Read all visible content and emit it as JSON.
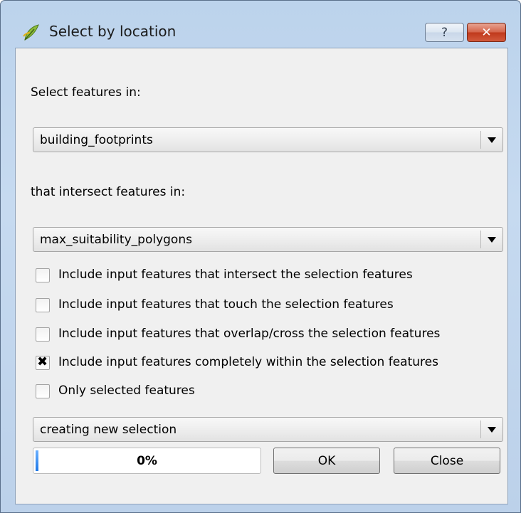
{
  "window": {
    "title": "Select by location",
    "help_glyph": "?",
    "close_glyph": "✕"
  },
  "form": {
    "select_label": "Select features in:",
    "select_layer": "building_footprints",
    "intersect_label": "that intersect features in:",
    "intersect_layer": "max_suitability_polygons",
    "options": [
      {
        "label": "Include input features that intersect the selection features",
        "checked": false
      },
      {
        "label": "Include input features that touch the selection features",
        "checked": false
      },
      {
        "label": "Include input features that overlap/cross the selection features",
        "checked": false
      },
      {
        "label": "Include input features completely within the selection features",
        "checked": true
      },
      {
        "label": "Only selected features",
        "checked": false
      }
    ],
    "check_glyph": "✖",
    "selection_mode": "creating new selection"
  },
  "footer": {
    "progress_text": "0%",
    "progress_value": 0,
    "ok_label": "OK",
    "close_label": "Close"
  },
  "colors": {
    "title_bar": "#c6daf0",
    "close_button": "#c0391c",
    "progress_fill": "#1e78e6"
  },
  "icons": {
    "app": "qgis-leaf-icon",
    "help": "question-mark-icon",
    "close": "close-icon",
    "dropdown": "chevron-down-icon"
  }
}
